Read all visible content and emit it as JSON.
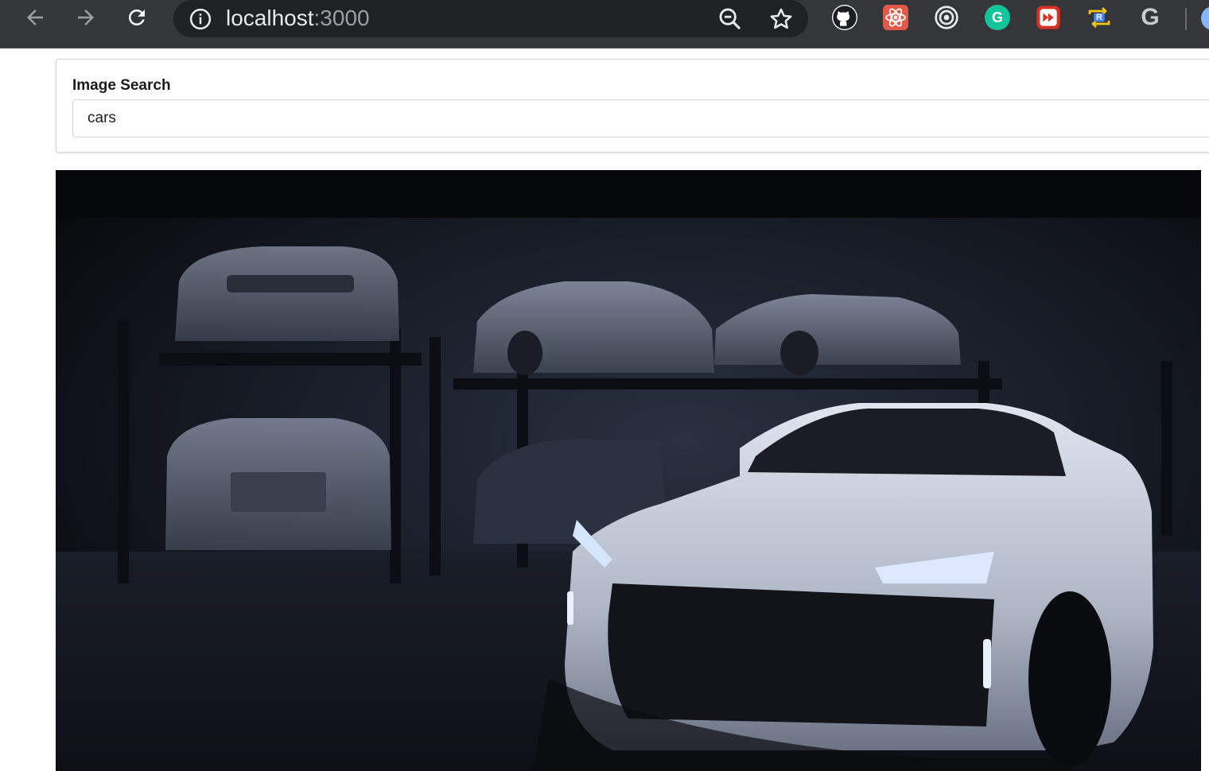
{
  "browser": {
    "url_host": "localhost",
    "url_port": ":3000",
    "extensions": [
      {
        "name": "github-extension"
      },
      {
        "name": "react-devtools-extension"
      },
      {
        "name": "target-extension"
      },
      {
        "name": "grammarly-extension",
        "letter": "G"
      },
      {
        "name": "media-extension"
      },
      {
        "name": "redux-extension",
        "letter": "R"
      },
      {
        "name": "google-extension",
        "letter": "G"
      }
    ]
  },
  "search": {
    "label": "Image Search",
    "value": "cars"
  },
  "results": [
    {
      "icon": "photo",
      "description": "car-garage-photo"
    }
  ],
  "colors": {
    "chrome_bg": "#35363a",
    "omnibox_bg": "#202124",
    "page_bg": "#ffffff",
    "border": "#d4d4d5"
  }
}
